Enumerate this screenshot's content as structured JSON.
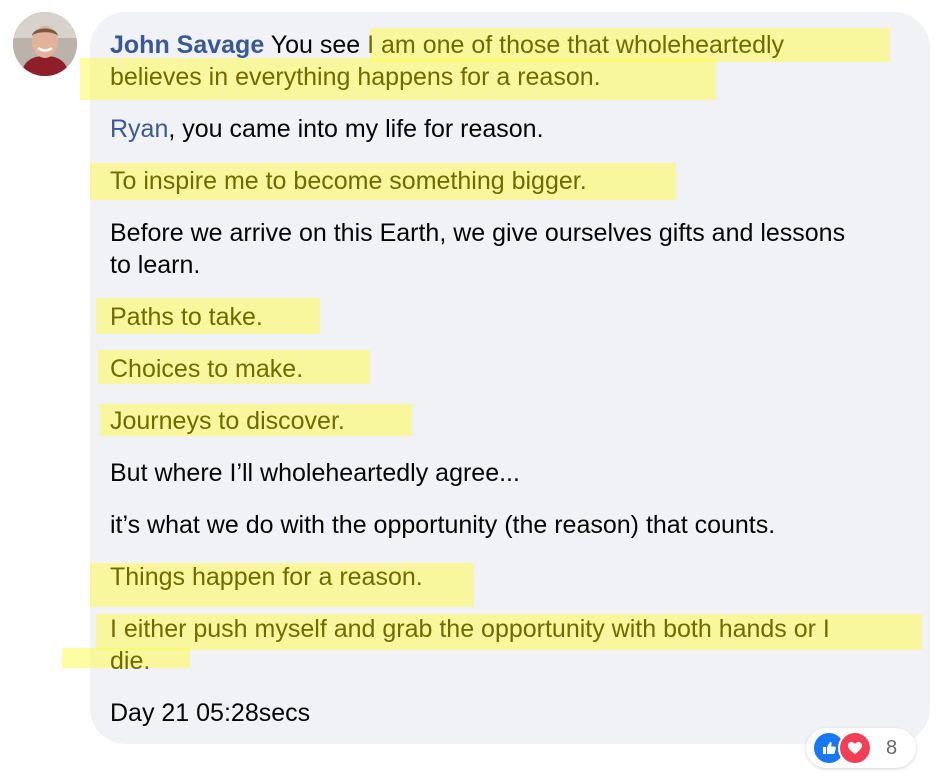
{
  "comment": {
    "author": "John Savage",
    "mention": "Ryan",
    "lines": {
      "l1_prefix": "You see ",
      "l1_highlight": "I am one of those that wholeheartedly",
      "l2": "believes in everything happens for a reason.",
      "l3_rest": ", you came into my life for reason.",
      "l4": "To inspire me to become something bigger.",
      "l5": "Before we arrive on this Earth, we give ourselves gifts and lessons",
      "l6": "to learn.",
      "l7": "Paths to take.",
      "l8": "Choices to make.",
      "l9": "Journeys to discover.",
      "l10": "But where I’ll wholeheartedly agree...",
      "l11": "it’s what we do with the opportunity (the reason) that counts.",
      "l12": "Things happen for a reason.",
      "l13": "I either push myself and grab the opportunity with both hands or I",
      "l14": "die.",
      "l15": "Day 21 05:28secs"
    }
  },
  "reactions": {
    "icons": [
      "like-icon",
      "love-icon"
    ],
    "count": "8",
    "colors": {
      "like": "#1877f2",
      "love": "#f33e58"
    }
  },
  "colors": {
    "bubble": "#f0f2f5",
    "author": "#385898",
    "highlight": "#fffb53"
  }
}
